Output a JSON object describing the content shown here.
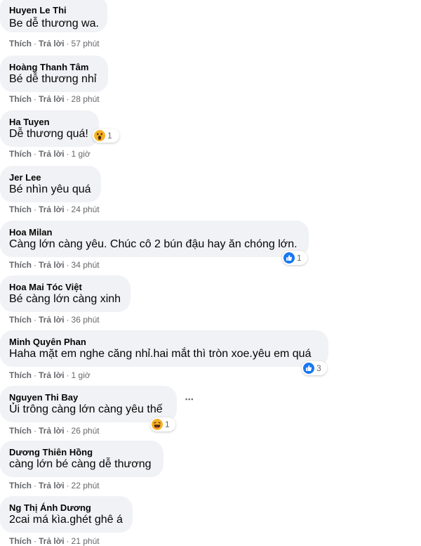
{
  "labels": {
    "like": "Thích",
    "reply": "Trả lời",
    "sep": "·"
  },
  "comments": [
    {
      "author": "Huyen Le Thi",
      "text": "Be dễ thương wa.",
      "time": "57 phút"
    },
    {
      "author": "Hoàng Thanh Tâm",
      "text": "Bé dễ thương nhỉ",
      "time": "28 phút"
    },
    {
      "author": "Ha Tuyen",
      "text": "Dễ thương quá!",
      "time": "1 giờ",
      "reaction": {
        "icon": "wow-reaction-icon",
        "count": "1"
      }
    },
    {
      "author": "Jer Lee",
      "text": "Bé nhìn yêu quá",
      "time": "24 phút"
    },
    {
      "author": "Hoa Milan",
      "text": "Càng lớn càng yêu. Chúc cô 2 bún đậu hay ăn chóng lớn.",
      "time": "34 phút",
      "reaction": {
        "icon": "like-reaction-icon",
        "count": "1"
      }
    },
    {
      "author": "Hoa Mai Tóc Việt",
      "text": "Bé càng lớn càng xinh",
      "time": "36 phút"
    },
    {
      "author": "Minh Quyên Phan",
      "text": "Haha mặt em nghe căng nhỉ.hai mắt thì tròn xoe.yêu em quá",
      "time": "1 giờ",
      "reaction": {
        "icon": "like-reaction-icon",
        "count": "3"
      }
    },
    {
      "author": "Nguyen Thi Bay",
      "text": "Ủi trông càng lớn càng yêu thế",
      "time": "26 phút",
      "reaction": {
        "icon": "haha-reaction-icon",
        "count": "1"
      },
      "more": "•••"
    },
    {
      "author": "Dương Thiên Hồng",
      "text": "càng lớn bé càng dễ thương",
      "time": "22 phút"
    },
    {
      "author": "Ng Thị Ánh Dương",
      "text": "2cai má kìa.ghét ghê á",
      "time": "21 phút"
    }
  ],
  "colors": {
    "bubble": "#f0f2f5",
    "meta": "#65676b",
    "like_blue": "#1877f2",
    "wow_yellow": "#f7b125"
  }
}
